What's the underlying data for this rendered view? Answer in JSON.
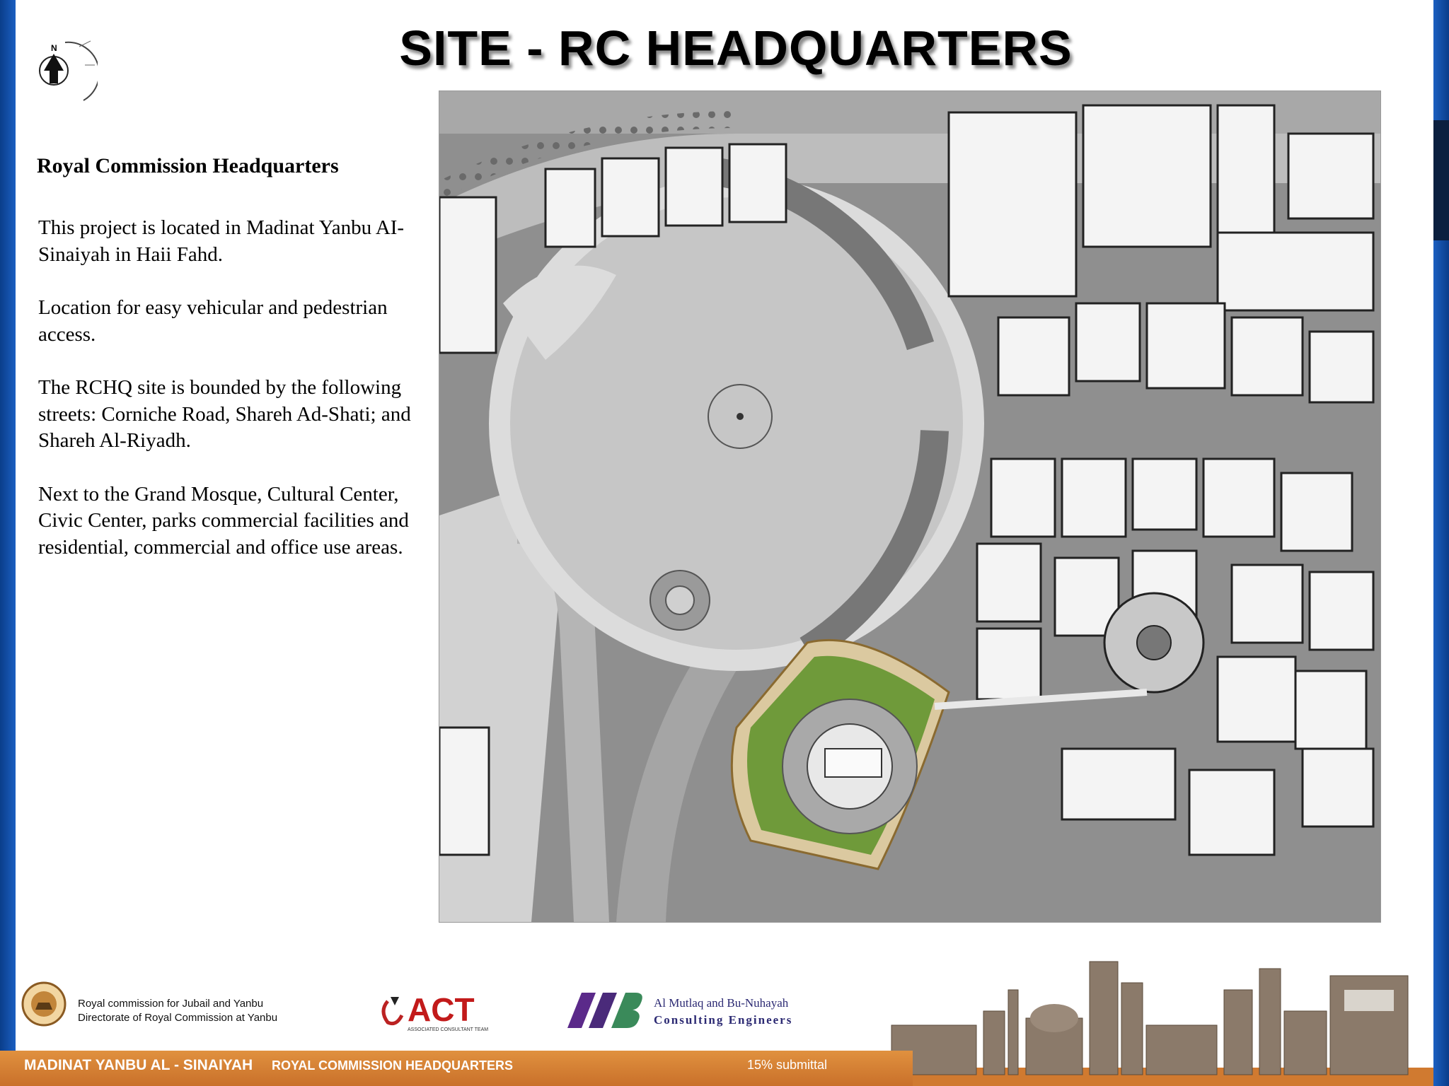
{
  "slide": {
    "title": "SITE - RC HEADQUARTERS",
    "heading": "Royal Commission Headquarters",
    "paragraphs": [
      "This project is located in Madinat Yanbu AI-Sinaiyah in Haii Fahd.",
      "Location for easy vehicular and pedestrian access.",
      "The RCHQ site is bounded by the following streets: Corniche Road, Shareh Ad-Shati; and Shareh Al-Riyadh.",
      "Next to the Grand Mosque, Cultural Center, Civic Center, parks commercial facilities and residential, commercial and office use areas."
    ]
  },
  "compass": {
    "label": "N"
  },
  "logos": {
    "rc_line1": "Royal commission for Jubail and Yanbu",
    "rc_line2": "Directorate of Royal Commission at Yanbu",
    "act_name": "ACT",
    "act_sub": "ASSOCIATED CONSULTANT TEAM",
    "mb_line1": "Al Mutlaq and Bu-Nuhayah",
    "mb_line2": "Consulting Engineers"
  },
  "footer": {
    "project": "MADINAT YANBU AL - SINAIYAH",
    "subject": "ROYAL COMMISSION HEADQUARTERS",
    "status": "15% submittal"
  },
  "colors": {
    "frame_blue": "#1b5fc1",
    "footer_orange": "#d07a30",
    "site_green": "#6f9a3a",
    "water_grey": "#c9c9c9"
  }
}
